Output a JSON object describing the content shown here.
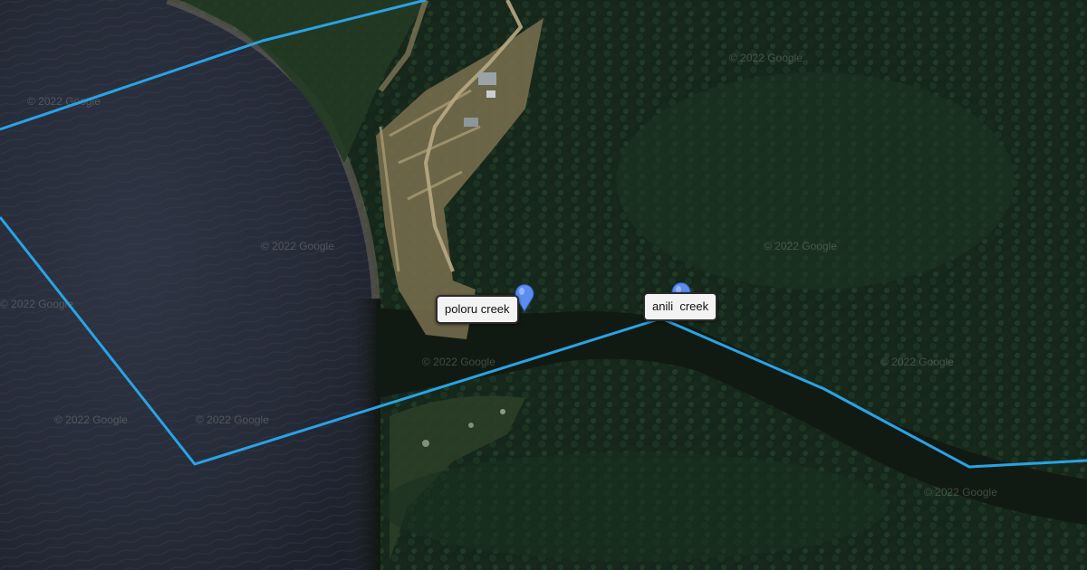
{
  "map": {
    "type": "satellite",
    "watermark": "© 2022 Google",
    "boundary_color": "#29a3e6",
    "marker_color": "#5b8def"
  },
  "places": [
    {
      "name": "poloru creek",
      "icon": "map-pin-icon"
    },
    {
      "name": "anili  creek",
      "icon": "map-pin-icon"
    }
  ]
}
